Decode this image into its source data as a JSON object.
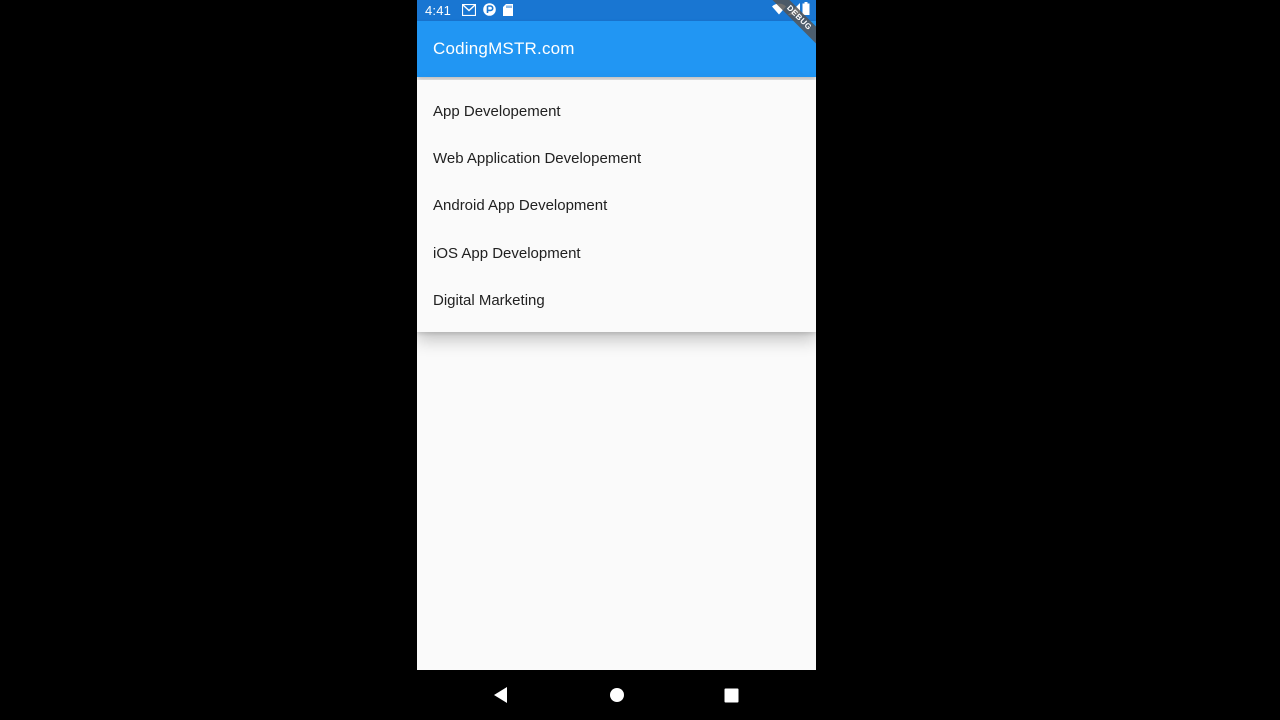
{
  "status_bar": {
    "time": "4:41",
    "left_icons": [
      "gmail-icon",
      "app-icon",
      "sd-card-icon"
    ],
    "right_icons": [
      "wifi-icon",
      "signal-icon",
      "battery-icon"
    ]
  },
  "app_bar": {
    "title": "CodingMSTR.com",
    "debug_label": "DEBUG"
  },
  "menu": {
    "items": [
      {
        "label": "App Developement"
      },
      {
        "label": "Web Application Developement"
      },
      {
        "label": "Android App Development"
      },
      {
        "label": "iOS App Development"
      },
      {
        "label": "Digital Marketing"
      }
    ]
  },
  "nav_bar": {
    "buttons": [
      "back-icon",
      "home-icon",
      "recents-icon"
    ]
  },
  "colors": {
    "status_bar": "#1976D2",
    "app_bar": "#2196F3",
    "background": "#FAFAFA",
    "text": "#212121"
  }
}
